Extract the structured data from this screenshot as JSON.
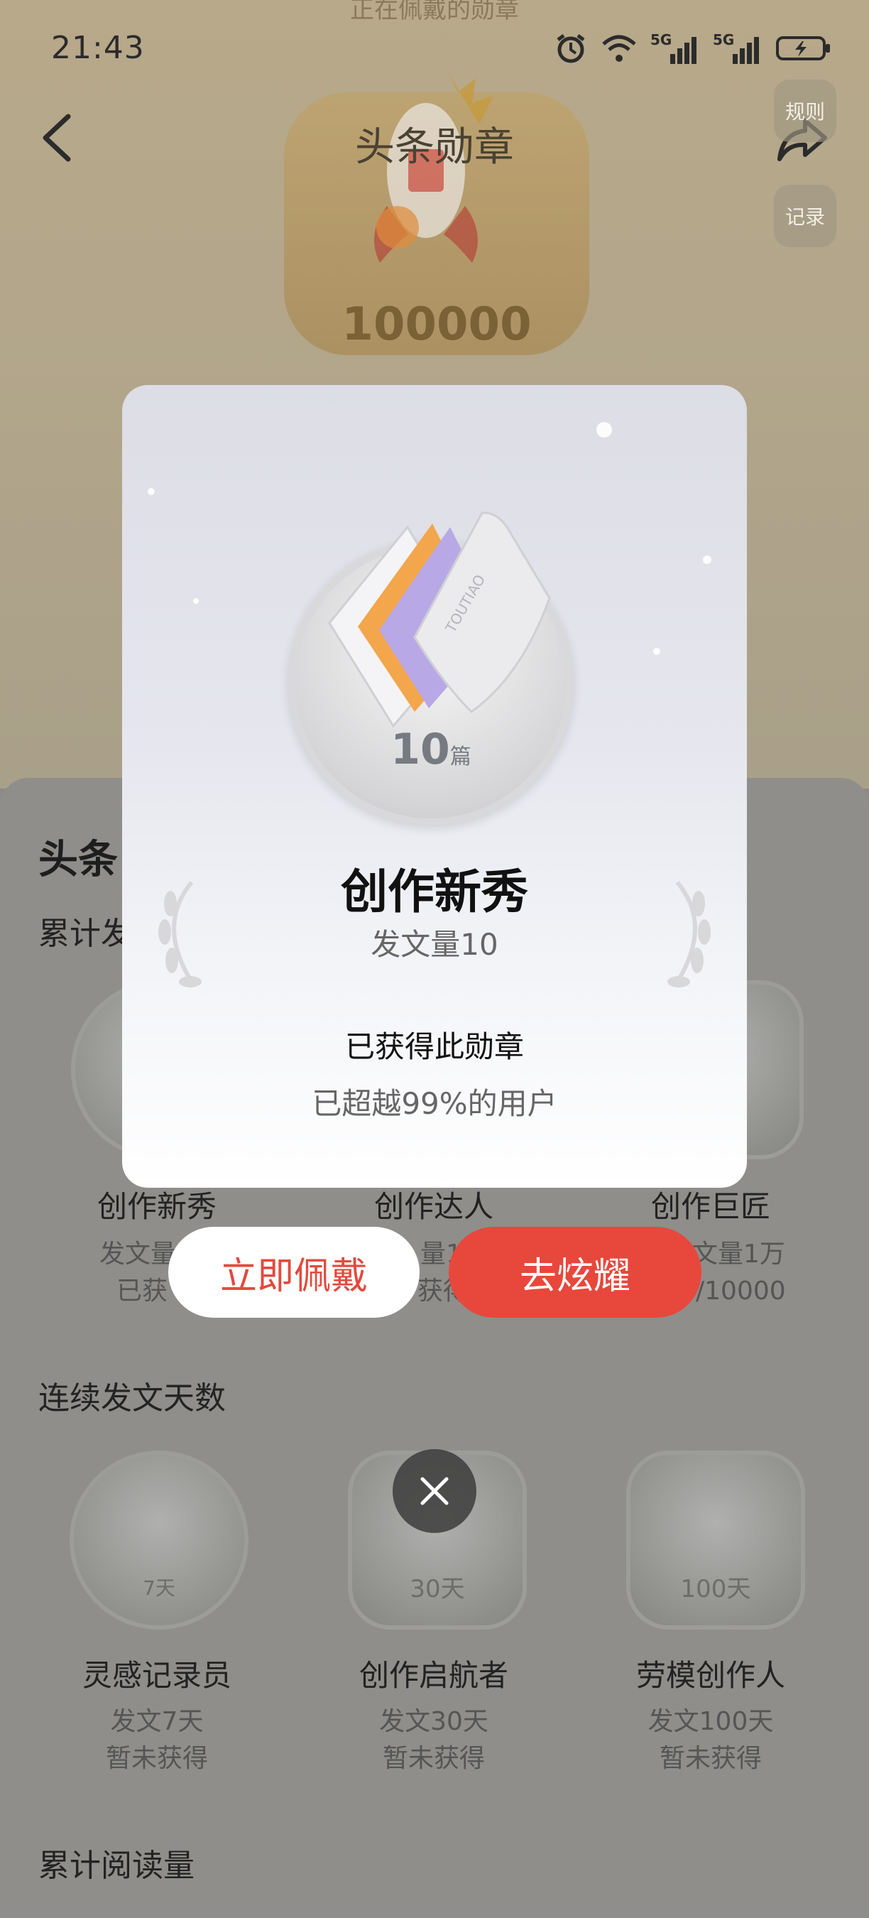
{
  "status_bar": {
    "time": "21:43",
    "network_1": "5G",
    "network_2": "5G"
  },
  "header": {
    "wearing_label": "正在佩戴的勋章",
    "title": "头条勋章",
    "rules_label": "规则",
    "records_label": "记录",
    "hero_badge_value": "100000"
  },
  "page": {
    "heading_partial": "头条",
    "section_cumulative_posts_partial": "累计发",
    "section_consecutive_days": "连续发文天数",
    "section_cumulative_reads": "累计阅读量"
  },
  "posts_badges": [
    {
      "name": "创作新秀",
      "line1": "发文量",
      "line2": "已获"
    },
    {
      "name": "创作达人",
      "line1": "量1",
      "line2": "获得"
    },
    {
      "name": "创作巨匠",
      "line1": "文量1万",
      "line2": "/10000"
    }
  ],
  "days_badges": [
    {
      "name": "灵感记录员",
      "line1": "发文7天",
      "line2": "暂未获得",
      "badge_label": "7天"
    },
    {
      "name": "创作启航者",
      "line1": "发文30天",
      "line2": "暂未获得",
      "badge_label": "30天"
    },
    {
      "name": "劳模创作人",
      "line1": "发文100天",
      "line2": "暂未获得",
      "badge_label": "100天"
    }
  ],
  "modal": {
    "badge_number": "10",
    "badge_unit": "篇",
    "book_brand": "TOUTIAO",
    "title": "创作新秀",
    "subtitle": "发文量10",
    "status": "已获得此勋章",
    "rank": "已超越99%的用户",
    "wear_button": "立即佩戴",
    "show_button": "去炫耀"
  },
  "colors": {
    "primary_red": "#e8473c",
    "overlay": "#8f8e8a"
  }
}
